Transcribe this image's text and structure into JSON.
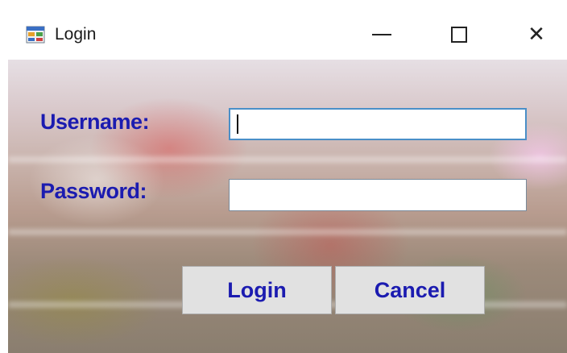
{
  "window": {
    "title": "Login",
    "icon": "app-form-icon"
  },
  "caption_buttons": {
    "minimize_icon": "minimize-icon",
    "maximize_icon": "maximize-icon",
    "close_icon": "close-icon",
    "close_glyph": "✕"
  },
  "form": {
    "username_label": "Username:",
    "username_value": "",
    "password_label": "Password:",
    "password_value": ""
  },
  "buttons": {
    "login_label": "Login",
    "cancel_label": "Cancel"
  },
  "colors": {
    "label_text": "#1b1bb0",
    "button_face": "#e1e1e1",
    "focus_border": "#4a8fc8"
  }
}
